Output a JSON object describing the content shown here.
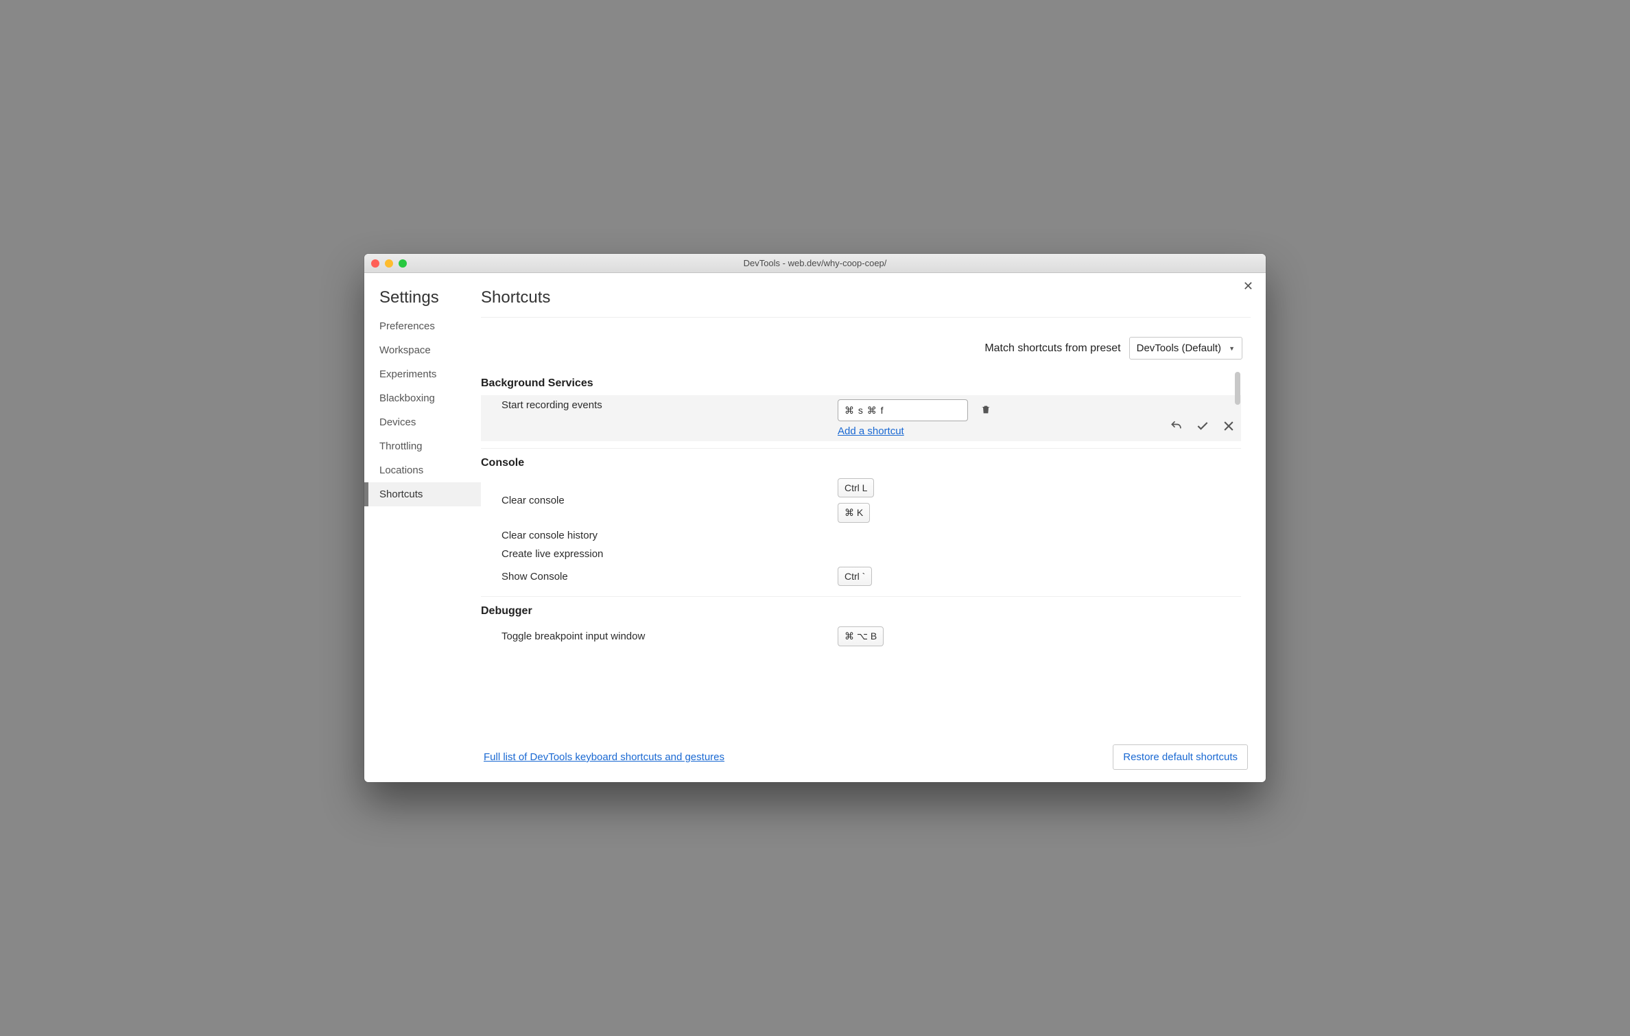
{
  "window_title": "DevTools - web.dev/why-coop-coep/",
  "sidebar": {
    "title": "Settings",
    "items": [
      {
        "label": "Preferences",
        "active": false
      },
      {
        "label": "Workspace",
        "active": false
      },
      {
        "label": "Experiments",
        "active": false
      },
      {
        "label": "Blackboxing",
        "active": false
      },
      {
        "label": "Devices",
        "active": false
      },
      {
        "label": "Throttling",
        "active": false
      },
      {
        "label": "Locations",
        "active": false
      },
      {
        "label": "Shortcuts",
        "active": true
      }
    ]
  },
  "main": {
    "title": "Shortcuts",
    "preset_label": "Match shortcuts from preset",
    "preset_value": "DevTools (Default)",
    "add_shortcut_label": "Add a shortcut",
    "sections": [
      {
        "heading": "Background Services",
        "rows": [
          {
            "label": "Start recording events",
            "editing": true,
            "edit_value": "⌘ s ⌘ f"
          }
        ]
      },
      {
        "heading": "Console",
        "rows": [
          {
            "label": "Clear console",
            "keys": [
              "Ctrl L",
              "⌘ K"
            ]
          },
          {
            "label": "Clear console history",
            "keys": []
          },
          {
            "label": "Create live expression",
            "keys": []
          },
          {
            "label": "Show Console",
            "keys": [
              "Ctrl `"
            ]
          }
        ]
      },
      {
        "heading": "Debugger",
        "rows": [
          {
            "label": "Toggle breakpoint input window",
            "keys": [
              "⌘ ⌥ B"
            ]
          }
        ]
      }
    ],
    "footer_link": "Full list of DevTools keyboard shortcuts and gestures",
    "restore_button": "Restore default shortcuts"
  }
}
